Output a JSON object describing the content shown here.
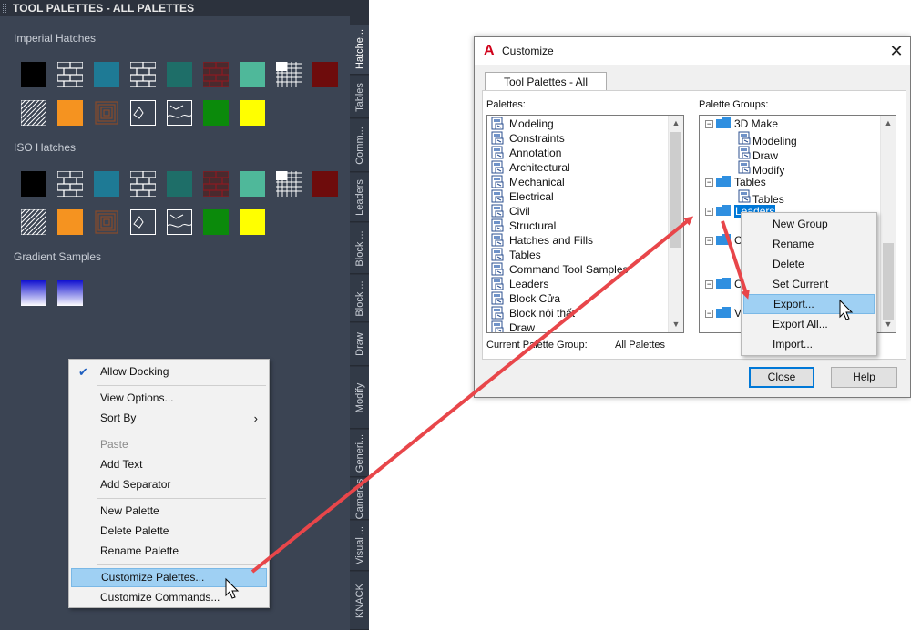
{
  "palette": {
    "title": "TOOL PALETTES - ALL PALETTES",
    "sections": {
      "imperial": "Imperial Hatches",
      "iso": "ISO Hatches",
      "gradient": "Gradient Samples"
    },
    "tabs": [
      "Hatche...",
      "Tables",
      "Comm...",
      "Leaders",
      "Block ...",
      "Block ...",
      "Draw",
      "Modify",
      "Generi...",
      "Cameras",
      "Visual ...",
      "KNACK"
    ]
  },
  "context_menu": {
    "items": [
      "Allow Docking",
      "View Options...",
      "Sort By",
      "Paste",
      "Add Text",
      "Add Separator",
      "New Palette",
      "Delete Palette",
      "Rename Palette",
      "Customize Palettes...",
      "Customize Commands..."
    ]
  },
  "dialog": {
    "logo": "A",
    "title": "Customize",
    "close": "✕",
    "tab": "Tool Palettes - All Palettes",
    "palettes_label": "Palettes:",
    "groups_label": "Palette Groups:",
    "palettes": [
      "Modeling",
      "Constraints",
      "Annotation",
      "Architectural",
      "Mechanical",
      "Electrical",
      "Civil",
      "Structural",
      "Hatches and Fills",
      "Tables",
      "Command Tool Samples",
      "Leaders",
      "Block Cửa",
      "Block nội thất",
      "Draw"
    ],
    "tree": {
      "g1": "3D Make",
      "g1_children": [
        "Modeling",
        "Draw",
        "Modify"
      ],
      "g2": "Tables",
      "g2_child": "Tables",
      "g3": "Leaders",
      "partial": [
        "C",
        "C",
        "V"
      ]
    },
    "current_group_label": "Current Palette Group:",
    "current_group_value": "All Palettes",
    "close_button": "Close",
    "help_button": "Help"
  },
  "group_menu": {
    "items": [
      "New Group",
      "Rename",
      "Delete",
      "Set Current",
      "Export...",
      "Export All...",
      "Import..."
    ]
  },
  "colors": {
    "palette_bg": "#3b4453",
    "highlight": "#9fd0f3",
    "arrow": "#e8464a",
    "selection": "#0078d7"
  }
}
